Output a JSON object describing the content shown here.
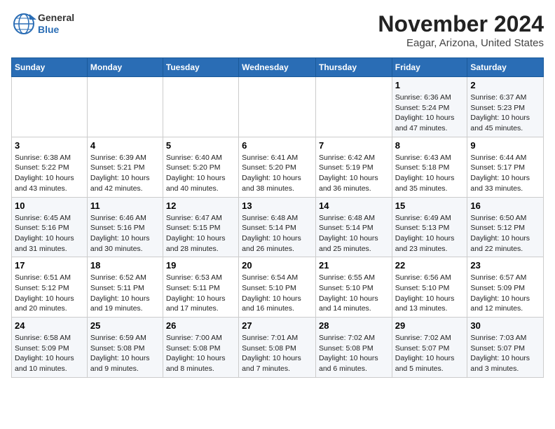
{
  "logo": {
    "line1": "General",
    "line2": "Blue"
  },
  "title": "November 2024",
  "subtitle": "Eagar, Arizona, United States",
  "days_of_week": [
    "Sunday",
    "Monday",
    "Tuesday",
    "Wednesday",
    "Thursday",
    "Friday",
    "Saturday"
  ],
  "weeks": [
    [
      {
        "day": "",
        "info": ""
      },
      {
        "day": "",
        "info": ""
      },
      {
        "day": "",
        "info": ""
      },
      {
        "day": "",
        "info": ""
      },
      {
        "day": "",
        "info": ""
      },
      {
        "day": "1",
        "info": "Sunrise: 6:36 AM\nSunset: 5:24 PM\nDaylight: 10 hours\nand 47 minutes."
      },
      {
        "day": "2",
        "info": "Sunrise: 6:37 AM\nSunset: 5:23 PM\nDaylight: 10 hours\nand 45 minutes."
      }
    ],
    [
      {
        "day": "3",
        "info": "Sunrise: 6:38 AM\nSunset: 5:22 PM\nDaylight: 10 hours\nand 43 minutes."
      },
      {
        "day": "4",
        "info": "Sunrise: 6:39 AM\nSunset: 5:21 PM\nDaylight: 10 hours\nand 42 minutes."
      },
      {
        "day": "5",
        "info": "Sunrise: 6:40 AM\nSunset: 5:20 PM\nDaylight: 10 hours\nand 40 minutes."
      },
      {
        "day": "6",
        "info": "Sunrise: 6:41 AM\nSunset: 5:20 PM\nDaylight: 10 hours\nand 38 minutes."
      },
      {
        "day": "7",
        "info": "Sunrise: 6:42 AM\nSunset: 5:19 PM\nDaylight: 10 hours\nand 36 minutes."
      },
      {
        "day": "8",
        "info": "Sunrise: 6:43 AM\nSunset: 5:18 PM\nDaylight: 10 hours\nand 35 minutes."
      },
      {
        "day": "9",
        "info": "Sunrise: 6:44 AM\nSunset: 5:17 PM\nDaylight: 10 hours\nand 33 minutes."
      }
    ],
    [
      {
        "day": "10",
        "info": "Sunrise: 6:45 AM\nSunset: 5:16 PM\nDaylight: 10 hours\nand 31 minutes."
      },
      {
        "day": "11",
        "info": "Sunrise: 6:46 AM\nSunset: 5:16 PM\nDaylight: 10 hours\nand 30 minutes."
      },
      {
        "day": "12",
        "info": "Sunrise: 6:47 AM\nSunset: 5:15 PM\nDaylight: 10 hours\nand 28 minutes."
      },
      {
        "day": "13",
        "info": "Sunrise: 6:48 AM\nSunset: 5:14 PM\nDaylight: 10 hours\nand 26 minutes."
      },
      {
        "day": "14",
        "info": "Sunrise: 6:48 AM\nSunset: 5:14 PM\nDaylight: 10 hours\nand 25 minutes."
      },
      {
        "day": "15",
        "info": "Sunrise: 6:49 AM\nSunset: 5:13 PM\nDaylight: 10 hours\nand 23 minutes."
      },
      {
        "day": "16",
        "info": "Sunrise: 6:50 AM\nSunset: 5:12 PM\nDaylight: 10 hours\nand 22 minutes."
      }
    ],
    [
      {
        "day": "17",
        "info": "Sunrise: 6:51 AM\nSunset: 5:12 PM\nDaylight: 10 hours\nand 20 minutes."
      },
      {
        "day": "18",
        "info": "Sunrise: 6:52 AM\nSunset: 5:11 PM\nDaylight: 10 hours\nand 19 minutes."
      },
      {
        "day": "19",
        "info": "Sunrise: 6:53 AM\nSunset: 5:11 PM\nDaylight: 10 hours\nand 17 minutes."
      },
      {
        "day": "20",
        "info": "Sunrise: 6:54 AM\nSunset: 5:10 PM\nDaylight: 10 hours\nand 16 minutes."
      },
      {
        "day": "21",
        "info": "Sunrise: 6:55 AM\nSunset: 5:10 PM\nDaylight: 10 hours\nand 14 minutes."
      },
      {
        "day": "22",
        "info": "Sunrise: 6:56 AM\nSunset: 5:10 PM\nDaylight: 10 hours\nand 13 minutes."
      },
      {
        "day": "23",
        "info": "Sunrise: 6:57 AM\nSunset: 5:09 PM\nDaylight: 10 hours\nand 12 minutes."
      }
    ],
    [
      {
        "day": "24",
        "info": "Sunrise: 6:58 AM\nSunset: 5:09 PM\nDaylight: 10 hours\nand 10 minutes."
      },
      {
        "day": "25",
        "info": "Sunrise: 6:59 AM\nSunset: 5:08 PM\nDaylight: 10 hours\nand 9 minutes."
      },
      {
        "day": "26",
        "info": "Sunrise: 7:00 AM\nSunset: 5:08 PM\nDaylight: 10 hours\nand 8 minutes."
      },
      {
        "day": "27",
        "info": "Sunrise: 7:01 AM\nSunset: 5:08 PM\nDaylight: 10 hours\nand 7 minutes."
      },
      {
        "day": "28",
        "info": "Sunrise: 7:02 AM\nSunset: 5:08 PM\nDaylight: 10 hours\nand 6 minutes."
      },
      {
        "day": "29",
        "info": "Sunrise: 7:02 AM\nSunset: 5:07 PM\nDaylight: 10 hours\nand 5 minutes."
      },
      {
        "day": "30",
        "info": "Sunrise: 7:03 AM\nSunset: 5:07 PM\nDaylight: 10 hours\nand 3 minutes."
      }
    ]
  ]
}
